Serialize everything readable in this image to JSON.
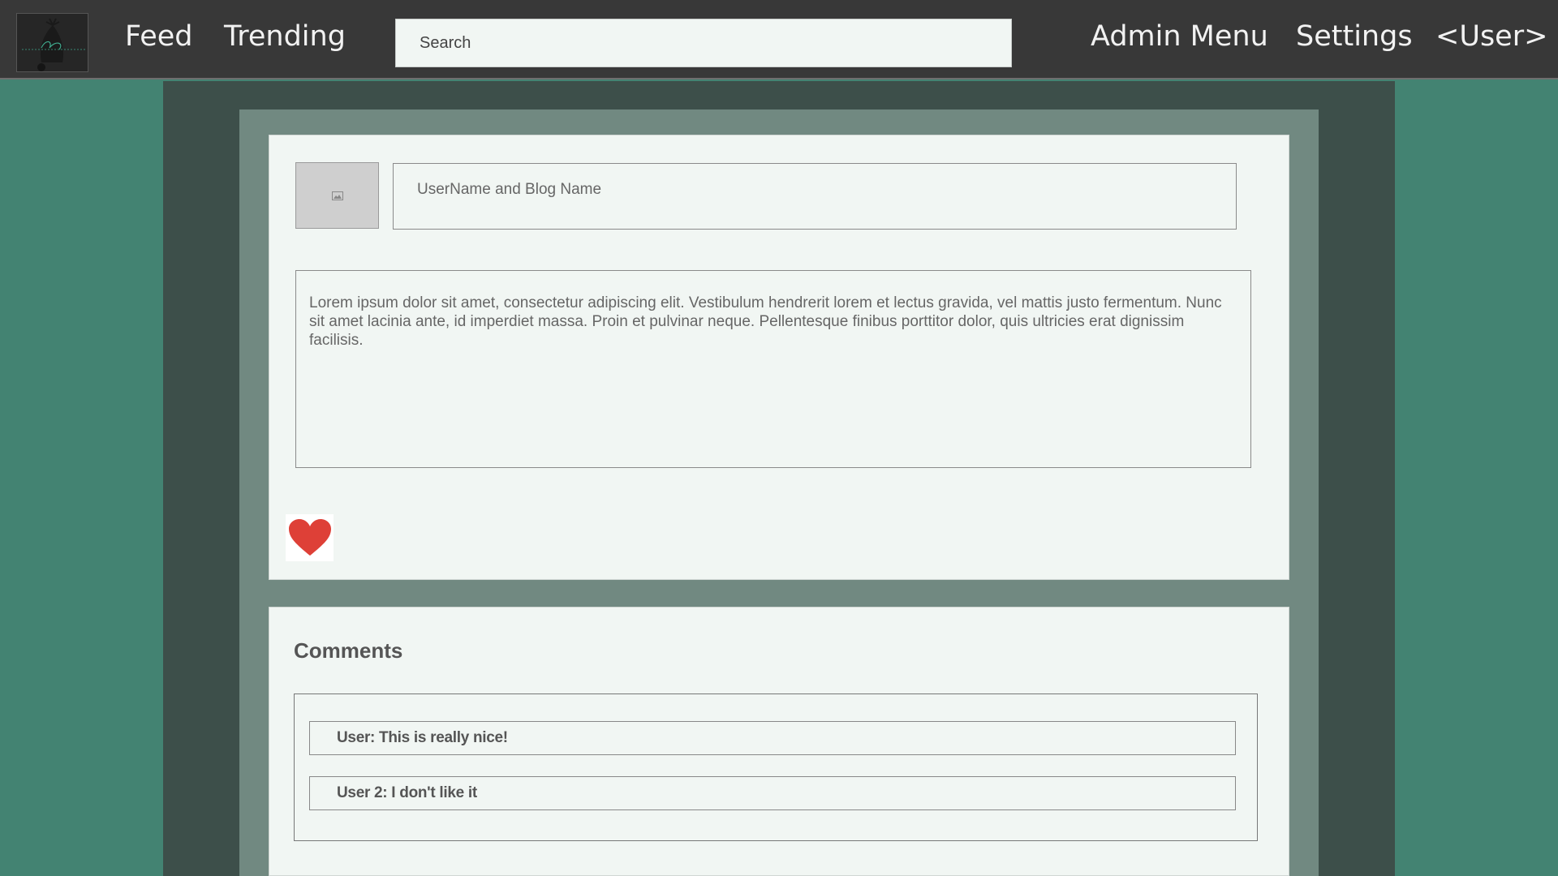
{
  "nav": {
    "feed_label": "Feed",
    "trending_label": "Trending",
    "admin_label": "Admin Menu",
    "settings_label": "Settings",
    "user_label": "<User>"
  },
  "search": {
    "placeholder": "Search"
  },
  "post": {
    "author_blog": "UserName and Blog Name",
    "body": "Lorem ipsum dolor sit amet, consectetur adipiscing elit. Vestibulum hendrerit lorem et lectus gravida, vel mattis justo fermentum. Nunc sit amet lacinia ante, id imperdiet massa. Proin et pulvinar neque. Pellentesque finibus porttitor dolor, quis ultricies erat dignissim facilisis."
  },
  "comments": {
    "title": "Comments",
    "items": [
      {
        "text": "User: This is really nice!"
      },
      {
        "text": "User 2: I don't like it"
      }
    ]
  },
  "icons": {
    "logo": "logo-image",
    "avatar": "image-placeholder-icon",
    "like": "heart-icon"
  },
  "colors": {
    "page_bg": "#438372",
    "topbar_bg": "#383838",
    "center_column": "#3d4f4a",
    "panel_frame": "#718981",
    "card_bg": "#f1f6f3",
    "heart": "#de4037"
  }
}
